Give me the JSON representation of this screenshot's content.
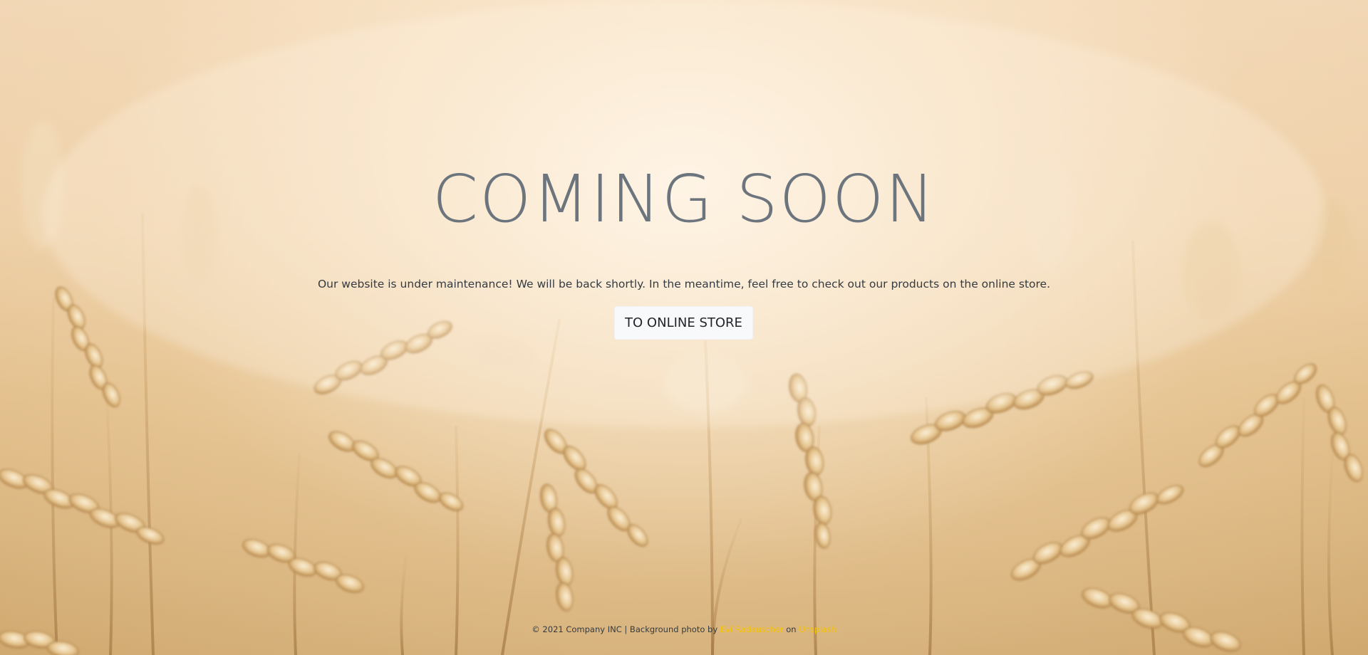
{
  "hero": {
    "title": "COMING SOON",
    "message": "Our website is under maintenance! We will be back shortly. In the meantime, feel free to check out our products on the online store.",
    "button_label": "TO ONLINE STORE"
  },
  "footer": {
    "copyright": "© 2021 Company INC | Background photo by",
    "photographer_link": "Evi Radauscher",
    "on_text": "on",
    "source_link": "Unsplash"
  },
  "colors": {
    "title": "#6c757d",
    "button_bg": "#f8f9fa",
    "link": "#f5c400",
    "text": "#343a40"
  }
}
